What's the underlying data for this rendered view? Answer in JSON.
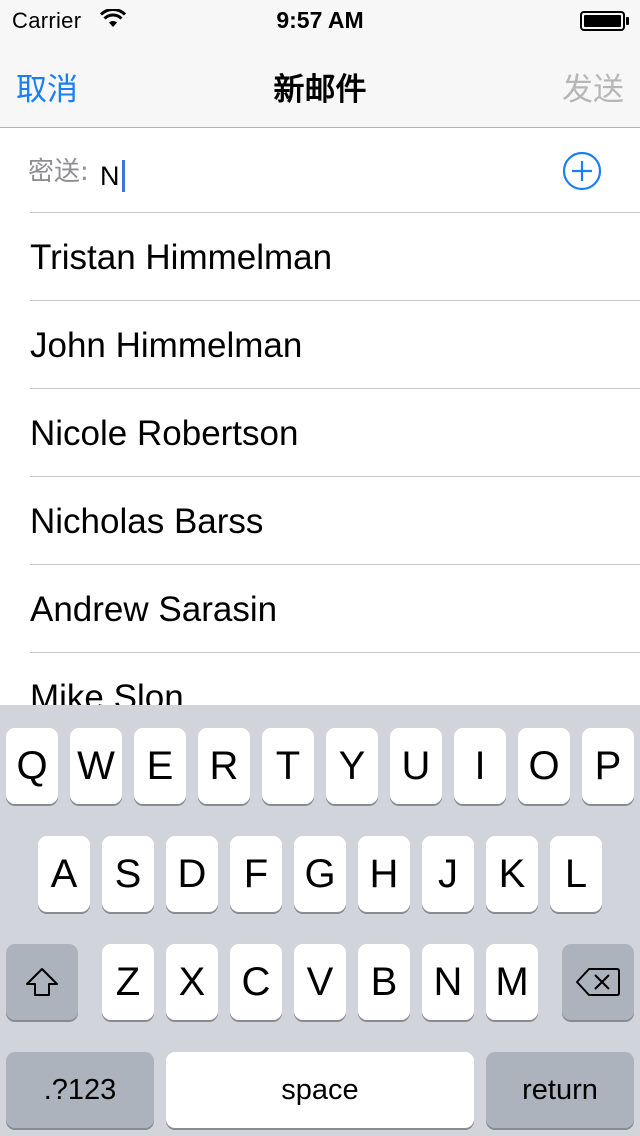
{
  "status_bar": {
    "carrier": "Carrier",
    "time": "9:57 AM",
    "wifi_icon": "wifi-icon",
    "battery_icon": "battery-icon"
  },
  "nav": {
    "cancel": "取消",
    "title": "新邮件",
    "send": "发送",
    "accent_color": "#1a7ff4",
    "disabled_color": "#b6b6b6"
  },
  "bcc": {
    "label": "密送:",
    "value": "N",
    "add_icon": "plus-circle-icon"
  },
  "suggestions": [
    "Tristan Himmelman",
    "John Himmelman",
    "Nicole Robertson",
    "Nicholas Barss",
    "Andrew Sarasin",
    "Mike Slon"
  ],
  "keyboard": {
    "row1": [
      "Q",
      "W",
      "E",
      "R",
      "T",
      "Y",
      "U",
      "I",
      "O",
      "P"
    ],
    "row2": [
      "A",
      "S",
      "D",
      "F",
      "G",
      "H",
      "J",
      "K",
      "L"
    ],
    "row3": [
      "Z",
      "X",
      "C",
      "V",
      "B",
      "N",
      "M"
    ],
    "shift_icon": "shift-icon",
    "delete_icon": "delete-icon",
    "numbers": ".?123",
    "space": "space",
    "return": "return"
  }
}
